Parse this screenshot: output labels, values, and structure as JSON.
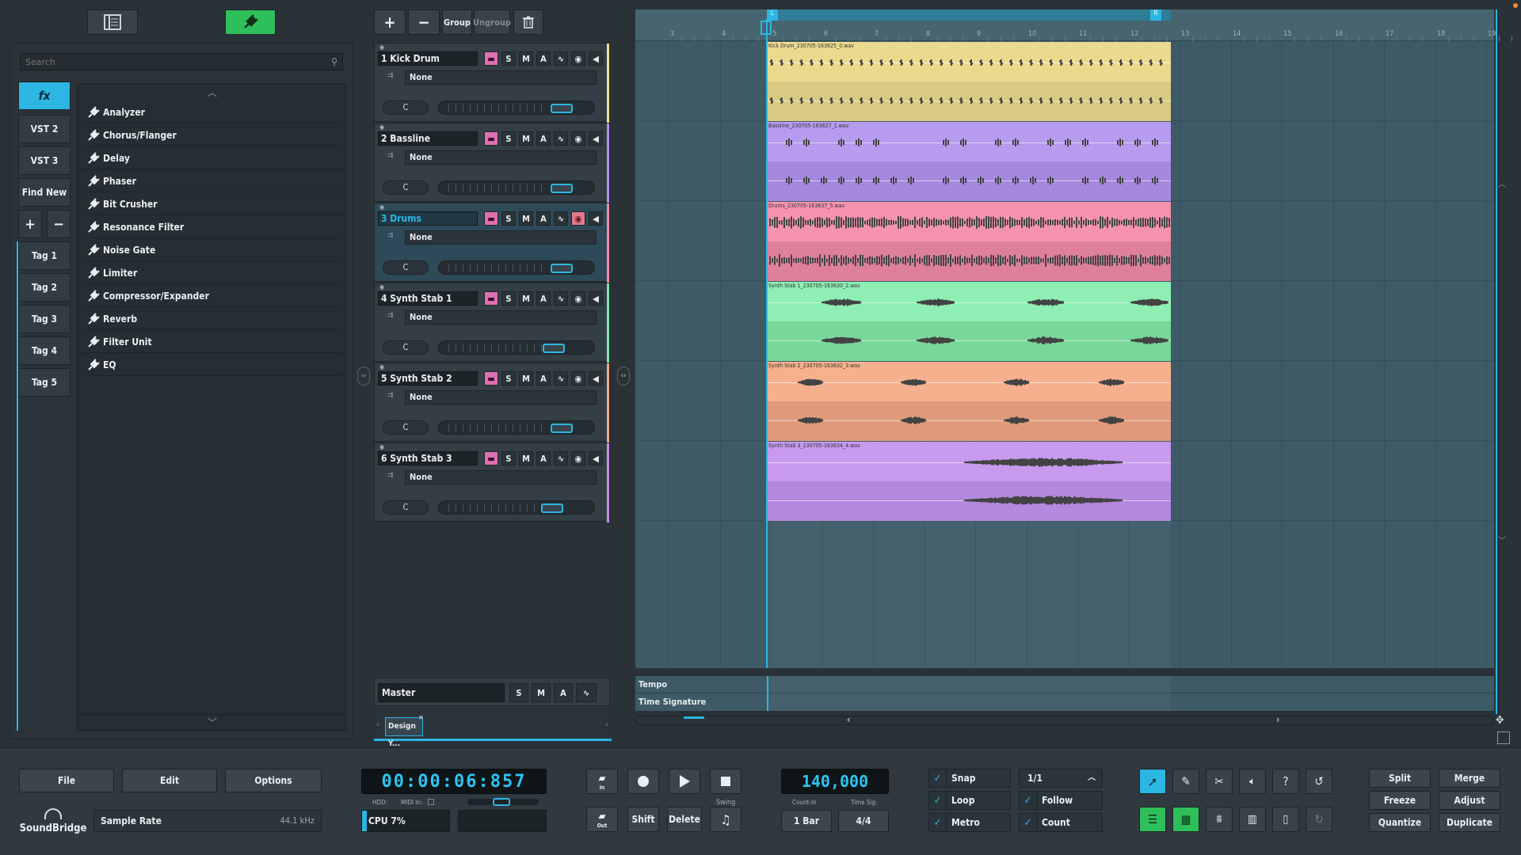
{
  "browser": {
    "search_placeholder": "Search",
    "tabs": [
      "fx",
      "VST 2",
      "VST 3",
      "Find New"
    ],
    "tags": [
      {
        "label": "Tag 1",
        "color": "#e0506a"
      },
      {
        "label": "Tag 2",
        "color": "#e6e05a"
      },
      {
        "label": "Tag 3",
        "color": "#5ad06a"
      },
      {
        "label": "Tag 4",
        "color": "#4ac8e8"
      },
      {
        "label": "Tag 5",
        "color": "#a070e0"
      }
    ],
    "plugins": [
      "Analyzer",
      "Chorus/Flanger",
      "Delay",
      "Phaser",
      "Bit Crusher",
      "Resonance Filter",
      "Noise Gate",
      "Limiter",
      "Compressor/Expander",
      "Reverb",
      "Filter Unit",
      "EQ"
    ]
  },
  "track_toolbar": {
    "group": "Group",
    "ungroup": "Ungroup"
  },
  "tracks": [
    {
      "name": "1 Kick Drum",
      "fx": "None",
      "pan": "C",
      "color": "#f3e08a",
      "clip_name": "Kick Drum_230705-163625_0.wav",
      "clip_color": "#ebd98a",
      "clip_color2": "#d8c87e",
      "volume": 0.84,
      "selected": false,
      "armed": false
    },
    {
      "name": "2 Bassline",
      "fx": "None",
      "pan": "C",
      "color": "#b48ef0",
      "clip_name": "Bassline_230705-163627_1.wav",
      "clip_color": "#b597ee",
      "clip_color2": "#a384de",
      "volume": 0.84,
      "selected": false,
      "armed": false
    },
    {
      "name": "3 Drums",
      "fx": "None",
      "pan": "C",
      "color": "#f58aa8",
      "clip_name": "Drums_230705-163637_5.wav",
      "clip_color": "#f58fac",
      "clip_color2": "#dd7b98",
      "volume": 0.84,
      "selected": true,
      "armed": true
    },
    {
      "name": "4 Synth Stab 1",
      "fx": "None",
      "pan": "C",
      "color": "#7ee8a8",
      "clip_name": "Synth Stab 1_230705-163630_2.wav",
      "clip_color": "#8aeeb0",
      "clip_color2": "#74d696",
      "volume": 0.78,
      "selected": false,
      "armed": false
    },
    {
      "name": "5 Synth Stab 2",
      "fx": "None",
      "pan": "C",
      "color": "#f5a884",
      "clip_name": "Synth Stab 2_230705-163632_3.wav",
      "clip_color": "#f5ad8a",
      "clip_color2": "#de9676",
      "volume": 0.84,
      "selected": false,
      "armed": false
    },
    {
      "name": "6 Synth Stab 3",
      "fx": "None",
      "pan": "C",
      "color": "#c58ef0",
      "clip_name": "Synth Stab 3_230705-163634_4.wav",
      "clip_color": "#c596ee",
      "clip_color2": "#b084de",
      "volume": 0.77,
      "selected": false,
      "armed": false
    }
  ],
  "master": {
    "name": "Master",
    "s": "S",
    "m": "M",
    "a": "A"
  },
  "project_tab": "Design Y...",
  "ruler": {
    "bars": [
      "3",
      "4",
      "5",
      "6",
      "7",
      "8",
      "9",
      "10",
      "11",
      "12",
      "13",
      "14",
      "15",
      "16",
      "17",
      "18",
      "19"
    ],
    "loop_left": "L",
    "loop_right": "R"
  },
  "automation_lanes": [
    "Tempo",
    "Time Signature"
  ],
  "menu": {
    "file": "File",
    "edit": "Edit",
    "options": "Options"
  },
  "sample_rate": {
    "label": "Sample Rate",
    "value": "44.1 kHz"
  },
  "logo_text": "SoundBridge",
  "transport": {
    "time": "00:00:06:857",
    "hdd": "HDD:",
    "midi_in": "MIDI In:",
    "cpu": "CPU 7%",
    "in_label": "In",
    "out_label": "Out",
    "shift": "Shift",
    "delete": "Delete",
    "swing": "Swing"
  },
  "tempo": {
    "value": "140,000",
    "count_in_label": "Count-In",
    "time_sig_label": "Time Sig.",
    "count_in": "1 Bar",
    "time_sig": "4/4"
  },
  "options": {
    "snap": "Snap",
    "loop": "Loop",
    "metro": "Metro",
    "quant": "1/1",
    "follow": "Follow",
    "count": "Count"
  },
  "edit_buttons": {
    "split": "Split",
    "merge": "Merge",
    "freeze": "Freeze",
    "adjust": "Adjust",
    "quantize": "Quantize",
    "duplicate": "Duplicate"
  },
  "colors": {
    "accent": "#2cb6e2",
    "record": "#e0506a",
    "active_green": "#2fbf5a"
  }
}
